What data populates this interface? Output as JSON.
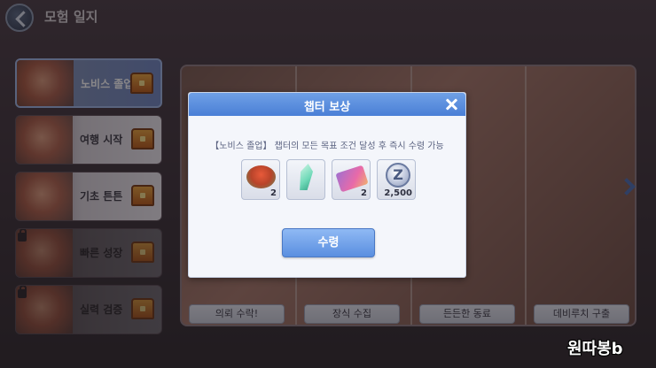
{
  "header": {
    "title": "모험 일지"
  },
  "sidebar": {
    "items": [
      {
        "label": "노비스 졸업",
        "state": "active"
      },
      {
        "label": "여행 시작",
        "state": "normal"
      },
      {
        "label": "기초 튼튼",
        "state": "normal"
      },
      {
        "label": "빠른 성장",
        "state": "locked"
      },
      {
        "label": "실력 검증",
        "state": "locked"
      }
    ]
  },
  "main": {
    "card_buttons": [
      "의뢰 수락!",
      "장식 수집",
      "든든한 동료",
      "데비루치 구출"
    ]
  },
  "modal": {
    "title": "챕터 보상",
    "description": "【노비스 졸업】 챕터의 모든 목표 조건 달성 후 즉시 수령 가능",
    "rewards": [
      {
        "icon": "food-icon",
        "quantity": "2"
      },
      {
        "icon": "crystal-icon",
        "quantity": ""
      },
      {
        "icon": "ticket-icon",
        "quantity": "2"
      },
      {
        "icon": "zeny-coin-icon",
        "quantity": "2,500",
        "symbol": "Z"
      }
    ],
    "claim_label": "수령"
  },
  "watermark": "원따봉b",
  "colors": {
    "accent": "#4a7fd6",
    "modal_bg": "#f4f6fb",
    "button": "#5a8fe0"
  }
}
